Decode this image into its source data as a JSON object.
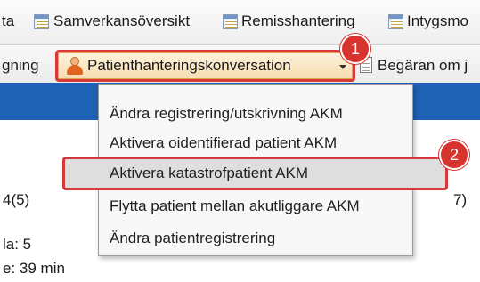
{
  "toolbar_top": {
    "items": [
      {
        "label": "ta"
      },
      {
        "label": "Samverkansöversikt",
        "icon": "window-grid-icon"
      },
      {
        "label": "Remisshantering",
        "icon": "window-grid-icon"
      },
      {
        "label": "Intygsmo",
        "icon": "window-grid-icon"
      }
    ]
  },
  "toolbar_second": {
    "left_label": "gning",
    "patient_button_label": "Patienthanteringskonversation",
    "patient_icon": "person-icon",
    "request_label": "Begäran om j",
    "request_icon": "document-icon"
  },
  "menu": {
    "items": [
      {
        "label": "Ändra registrering/utskrivning AKM"
      },
      {
        "label": "Aktivera oidentifierad patient AKM"
      },
      {
        "label": "Aktivera katastrofpatient AKM",
        "selected": true
      },
      {
        "label": "Flytta patient mellan akutliggare AKM"
      },
      {
        "label": "Ändra patientregistrering"
      }
    ]
  },
  "background_content": {
    "count_label": "4(5)",
    "right_fragment": "7)",
    "line1": "la: 5",
    "line2": "e: 39 min"
  },
  "callouts": {
    "step1": "1",
    "step2": "2"
  },
  "colors": {
    "accent_blue": "#1e62b3",
    "callout_red": "#d8342f",
    "button_orange": "#f6ddb0"
  }
}
